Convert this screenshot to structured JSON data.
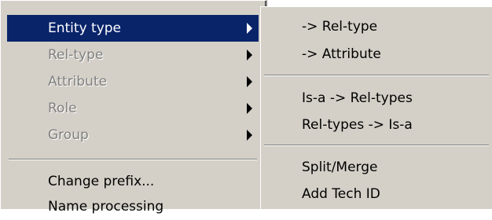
{
  "left_menu": {
    "items": [
      {
        "label": "Entity type",
        "state": "selected",
        "submenu": true
      },
      {
        "label": "Rel-type",
        "state": "disabled",
        "submenu": true
      },
      {
        "label": "Attribute",
        "state": "disabled",
        "submenu": true
      },
      {
        "label": "Role",
        "state": "disabled",
        "submenu": true
      },
      {
        "label": "Group",
        "state": "disabled",
        "submenu": true
      },
      {
        "label": "Change prefix...",
        "state": "enabled",
        "submenu": false
      },
      {
        "label": "Name processing",
        "state": "enabled",
        "submenu": false
      }
    ]
  },
  "submenu": {
    "items": [
      {
        "label": "-> Rel-type"
      },
      {
        "label": "-> Attribute"
      },
      {
        "label": "Is-a -> Rel-types"
      },
      {
        "label": "Rel-types -> Is-a"
      },
      {
        "label": "Split/Merge"
      },
      {
        "label": "Add Tech ID"
      }
    ]
  },
  "colors": {
    "menu_background": "#d4d0c8",
    "selection_background": "#0a246a",
    "disabled_text": "#808080"
  }
}
